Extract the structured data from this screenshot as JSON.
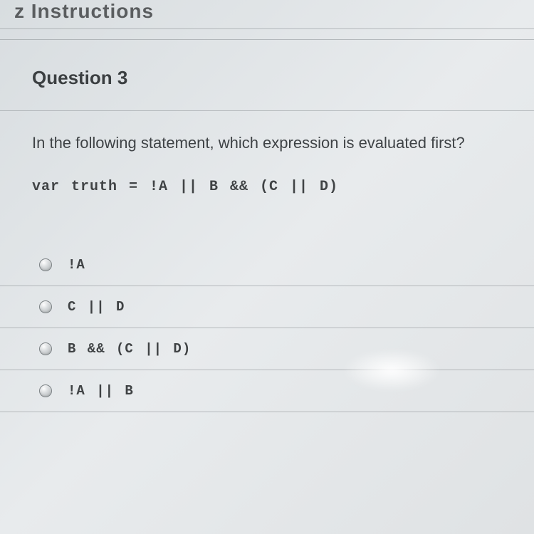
{
  "page_title_fragment": "z Instructions",
  "question": {
    "heading": "Question 3",
    "prompt": "In the following statement, which expression is evaluated first?",
    "code": "var truth = !A || B && (C || D)"
  },
  "options": [
    {
      "label": "!A"
    },
    {
      "label": "C || D"
    },
    {
      "label": "B && (C || D)"
    },
    {
      "label": "!A || B"
    }
  ]
}
